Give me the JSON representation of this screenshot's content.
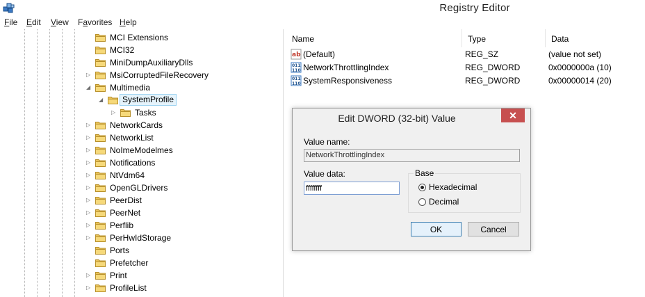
{
  "window": {
    "title": "Registry Editor",
    "icon": "regedit-icon"
  },
  "menu": [
    {
      "label": "File",
      "mnemonic": "F",
      "rest": "ile"
    },
    {
      "label": "Edit",
      "mnemonic": "E",
      "rest": "dit"
    },
    {
      "label": "View",
      "mnemonic": "V",
      "rest": "iew"
    },
    {
      "label": "Favorites",
      "mnemonic": "a",
      "pre": "F",
      "rest": "vorites"
    },
    {
      "label": "Help",
      "mnemonic": "H",
      "rest": "elp"
    }
  ],
  "tree": {
    "items": [
      {
        "label": "MCI Extensions",
        "expander": ""
      },
      {
        "label": "MCI32",
        "expander": ""
      },
      {
        "label": "MiniDumpAuxiliaryDlls",
        "expander": ""
      },
      {
        "label": "MsiCorruptedFileRecovery",
        "expander": "collapsed"
      },
      {
        "label": "Multimedia",
        "expander": "expanded"
      },
      {
        "label": "SystemProfile",
        "expander": "expanded",
        "selected": true
      },
      {
        "label": "Tasks",
        "expander": "collapsed"
      },
      {
        "label": "NetworkCards",
        "expander": "collapsed"
      },
      {
        "label": "NetworkList",
        "expander": "collapsed"
      },
      {
        "label": "NoImeModelmes",
        "expander": "collapsed"
      },
      {
        "label": "Notifications",
        "expander": "collapsed"
      },
      {
        "label": "NtVdm64",
        "expander": "collapsed"
      },
      {
        "label": "OpenGLDrivers",
        "expander": "collapsed"
      },
      {
        "label": "PeerDist",
        "expander": "collapsed"
      },
      {
        "label": "PeerNet",
        "expander": "collapsed"
      },
      {
        "label": "Perflib",
        "expander": "collapsed"
      },
      {
        "label": "PerHwIdStorage",
        "expander": "collapsed"
      },
      {
        "label": "Ports",
        "expander": ""
      },
      {
        "label": "Prefetcher",
        "expander": ""
      },
      {
        "label": "Print",
        "expander": "collapsed"
      },
      {
        "label": "ProfileList",
        "expander": "collapsed"
      }
    ]
  },
  "list": {
    "columns": [
      "Name",
      "Type",
      "Data"
    ],
    "rows": [
      {
        "icon": "string-value-icon",
        "name": "(Default)",
        "type": "REG_SZ",
        "data": "(value not set)"
      },
      {
        "icon": "dword-value-icon",
        "name": "NetworkThrottlingIndex",
        "type": "REG_DWORD",
        "data": "0x0000000a (10)"
      },
      {
        "icon": "dword-value-icon",
        "name": "SystemResponsiveness",
        "type": "REG_DWORD",
        "data": "0x00000014 (20)"
      }
    ]
  },
  "dialog": {
    "title": "Edit DWORD (32-bit) Value",
    "close_glyph": "✕",
    "value_name_label": "Value name:",
    "value_name": "NetworkThrottlingIndex",
    "value_data_label": "Value data:",
    "value_data": "ffffffff",
    "base_label": "Base",
    "hex_label": "Hexadecimal",
    "dec_label": "Decimal",
    "base_selected": "Hexadecimal",
    "ok_label": "OK",
    "cancel_label": "Cancel"
  },
  "colors": {
    "selection_bg": "#e5f3fb",
    "selection_border": "#99d1f0",
    "close_button": "#c75050",
    "folder": "#e8c25a"
  }
}
